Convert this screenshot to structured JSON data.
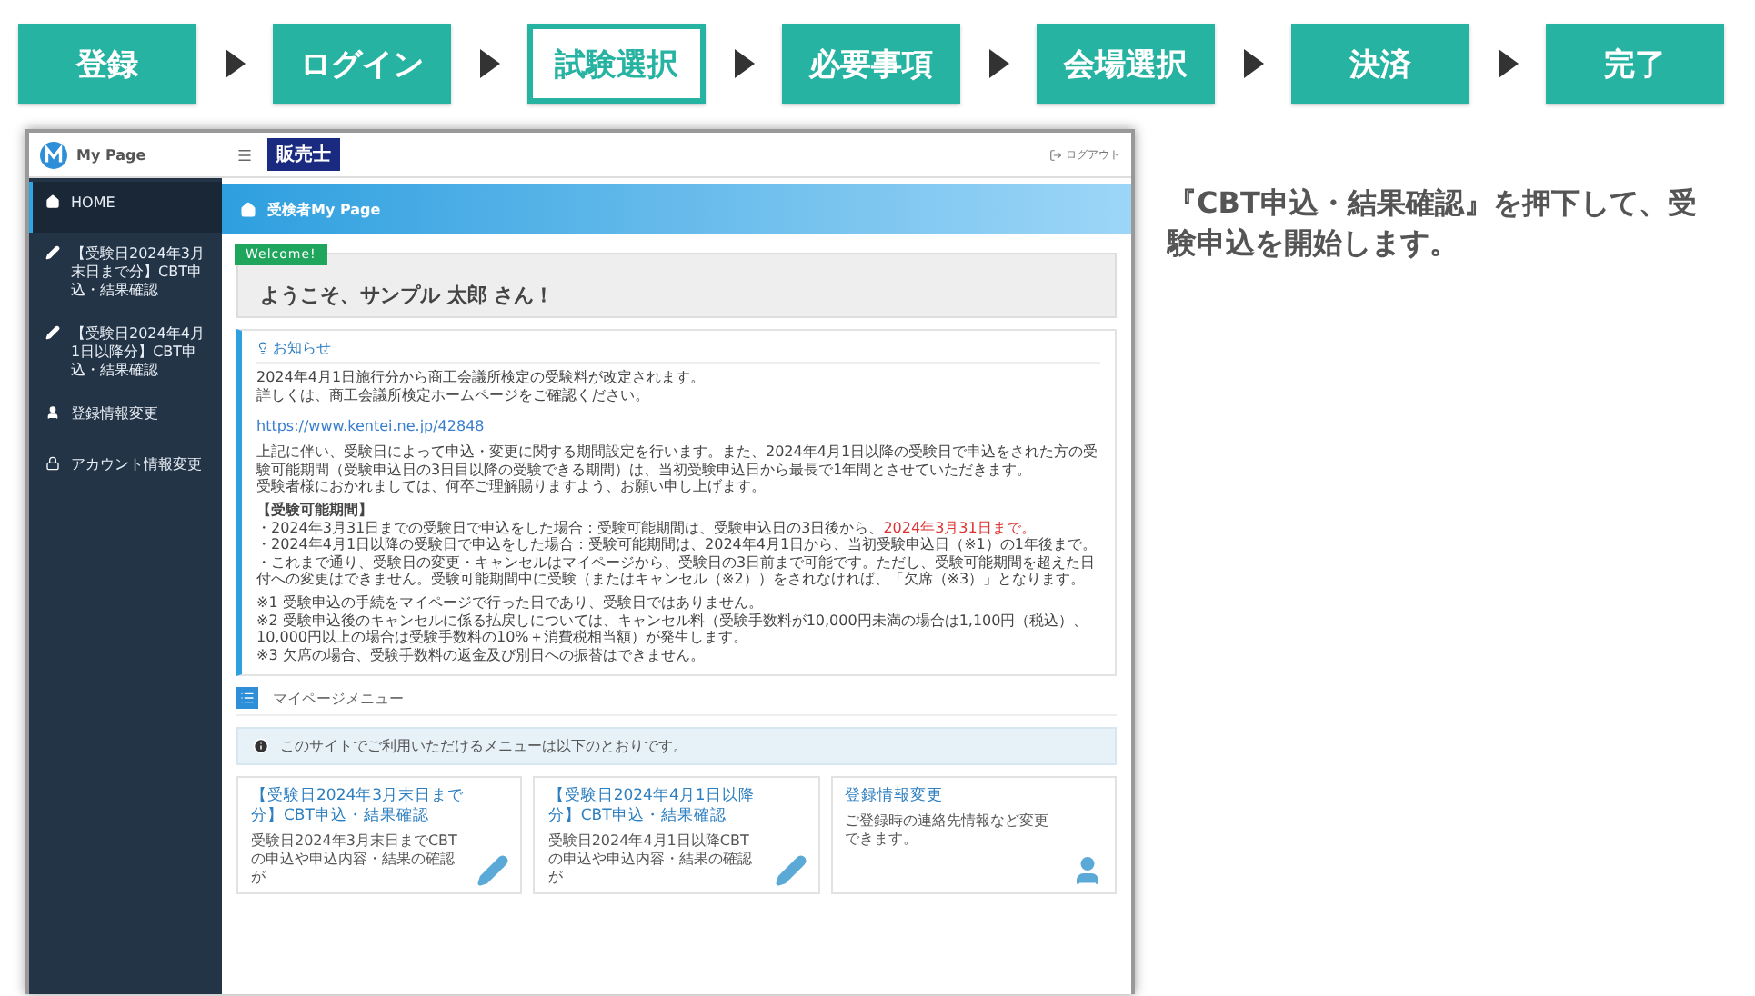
{
  "steps": [
    {
      "label": "登録",
      "selected": false
    },
    {
      "label": "ログイン",
      "selected": false
    },
    {
      "label": "試験選択",
      "selected": true
    },
    {
      "label": "必要事項",
      "selected": false
    },
    {
      "label": "会場選択",
      "selected": false
    },
    {
      "label": "決済",
      "selected": false
    },
    {
      "label": "完了",
      "selected": false
    }
  ],
  "app": {
    "logo": "My Page",
    "badge": "販売士",
    "logout": "ログアウト",
    "sidebar": {
      "items": [
        {
          "label": "HOME",
          "kind": "home",
          "selected": true
        },
        {
          "label": "【受験日2024年3月末日まで分】CBT申込・結果確認",
          "kind": "edit",
          "selected": false
        },
        {
          "label": "【受験日2024年4月1日以降分】CBT申込・結果確認",
          "kind": "edit",
          "selected": false
        },
        {
          "label": "登録情報変更",
          "kind": "profile",
          "selected": false
        },
        {
          "label": "アカウント情報変更",
          "kind": "account",
          "selected": false
        }
      ]
    },
    "banner": "受検者My Page",
    "welcome": {
      "tag": "Welcome!",
      "message": "ようこそ、サンプル 太郎 さん！"
    },
    "notice": {
      "title": "お知らせ",
      "blocks": [
        {
          "kind": "text",
          "text": "2024年4月1日施行分から商工会議所検定の受験料が改定されます。"
        },
        {
          "kind": "text",
          "text": "詳しくは、商工会議所検定ホームページをご確認ください。"
        },
        {
          "kind": "link",
          "text": "https://www.kentei.ne.jp/42848"
        },
        {
          "kind": "gap"
        },
        {
          "kind": "text",
          "text": "上記に伴い、受験日によって申込・変更に関する期間設定を行います。また、2024年4月1日以降の受験日で申込をされた方の受験可能期間（受験申込日の3日目以降の受験できる期間）は、当初受験申込日から最長で1年間とさせていただきます。"
        },
        {
          "kind": "text",
          "text": "受験者様におかれましては、何卒ご理解賜りますよう、お願い申し上げます。"
        },
        {
          "kind": "gap"
        },
        {
          "kind": "heading",
          "text": "【受験可能期間】"
        },
        {
          "kind": "text",
          "text": "・2024年3月31日までの受験日で申込をした場合：受験可能期間は、受験申込日の3日後から、",
          "highlight": "2024年3月31日まで。"
        },
        {
          "kind": "text",
          "text": "・2024年4月1日以降の受験日で申込をした場合：受験可能期間は、2024年4月1日から、当初受験申込日（※1）の1年後まで。"
        },
        {
          "kind": "text",
          "text": "・これまで通り、受験日の変更・キャンセルはマイページから、受験日の3日前まで可能です。ただし、受験可能期間を超えた日付への変更はできません。受験可能期間中に受験（またはキャンセル（※2））をされなければ、「欠席（※3）」となります。"
        },
        {
          "kind": "gap"
        },
        {
          "kind": "text",
          "text": "※1 受験申込の手続をマイページで行った日であり、受験日ではありません。"
        },
        {
          "kind": "text",
          "text": "※2 受験申込後のキャンセルに係る払戻しについては、キャンセル料（受験手数料が10,000円未満の場合は1,100円（税込）、10,000円以上の場合は受験手数料の10%＋消費税相当額）が発生します。"
        },
        {
          "kind": "text",
          "text": "※3 欠席の場合、受験手数料の返金及び別日への振替はできません。"
        }
      ]
    },
    "menu_title": "マイページメニュー",
    "info": "このサイトでご利用いただけるメニューは以下のとおりです。",
    "cards": [
      {
        "title": "【受験日2024年3月末日まで分】CBT申込・結果確認",
        "description": "受験日2024年3月末日までCBTの申込や申込内容・結果の確認が",
        "kind": "edit"
      },
      {
        "title": "【受験日2024年4月1日以降分】CBT申込・結果確認",
        "description": "受験日2024年4月1日以降CBTの申込や申込内容・結果の確認が",
        "kind": "edit"
      },
      {
        "title": "登録情報変更",
        "description": "ご登録時の連絡先情報など変更できます。",
        "kind": "profile"
      }
    ]
  },
  "caption": "『CBT申込・結果確認』を押下して、受験申込を開始します。"
}
